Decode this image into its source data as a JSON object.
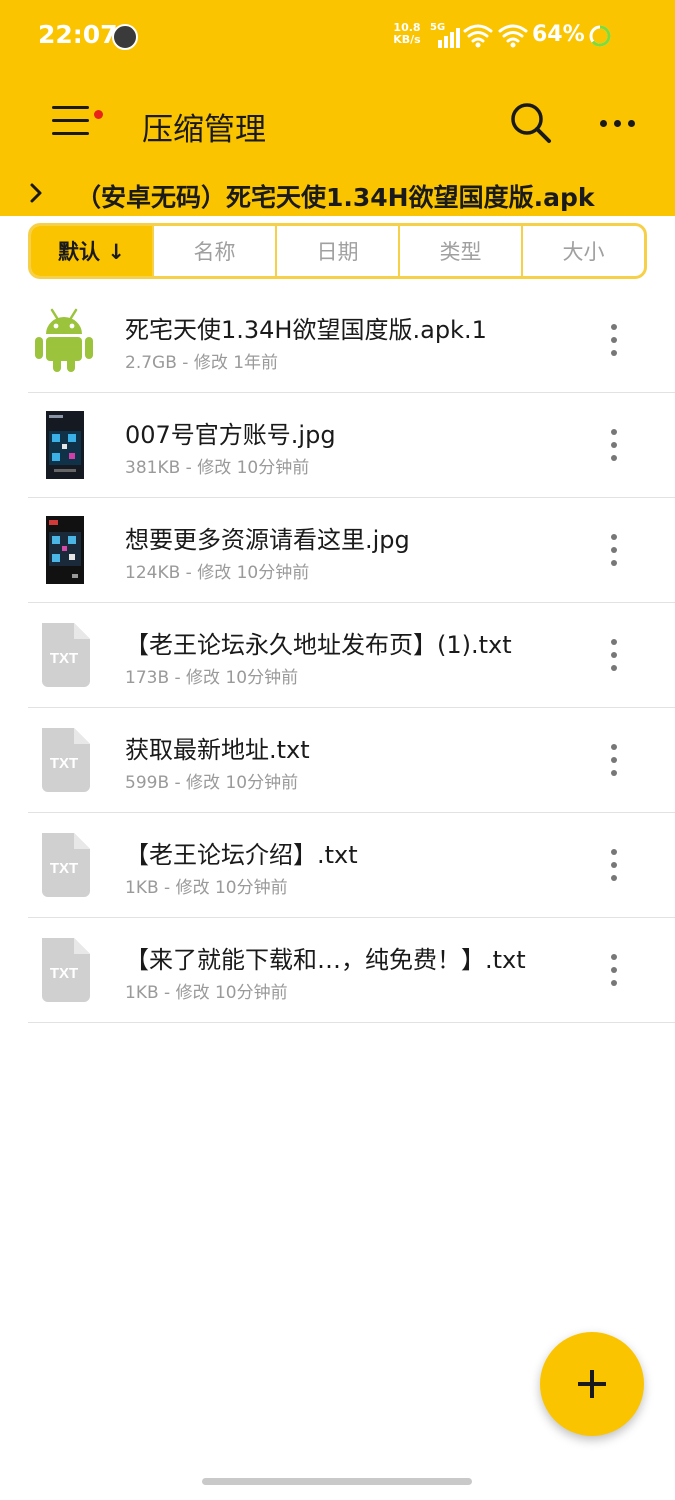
{
  "status_bar": {
    "time": "22:07",
    "net_speed_value": "10.8",
    "net_speed_unit": "KB/s",
    "network_type": "5G",
    "battery_percent": "64%",
    "battery_level": 0.64,
    "icons": [
      "avatar-icon",
      "signal-icon",
      "wifi-icon",
      "wifi-icon",
      "battery-ring-icon"
    ]
  },
  "toolbar": {
    "title": "压缩管理",
    "menu_icon": "hamburger-menu-icon",
    "search_icon": "search-icon",
    "more_icon": "more-dots-icon"
  },
  "breadcrumb": {
    "path": "（安卓无码）死宅天使1.34H欲望国度版.apk"
  },
  "sort_tabs": [
    {
      "label": "默认 ↓",
      "active": true
    },
    {
      "label": "名称",
      "active": false
    },
    {
      "label": "日期",
      "active": false
    },
    {
      "label": "类型",
      "active": false
    },
    {
      "label": "大小",
      "active": false
    }
  ],
  "files": [
    {
      "name": "死宅天使1.34H欲望国度版.apk.1",
      "meta": "2.7GB - 修改 1年前",
      "icon": "android-icon"
    },
    {
      "name": "007号官方账号.jpg",
      "meta": "381KB - 修改 10分钟前",
      "icon": "image-thumbnail"
    },
    {
      "name": "想要更多资源请看这里.jpg",
      "meta": "124KB - 修改 10分钟前",
      "icon": "image-thumbnail"
    },
    {
      "name": "【老王论坛永久地址发布页】(1).txt",
      "meta": "173B - 修改 10分钟前",
      "icon": "txt-file-icon",
      "icon_label": "TXT"
    },
    {
      "name": "获取最新地址.txt",
      "meta": "599B - 修改 10分钟前",
      "icon": "txt-file-icon",
      "icon_label": "TXT"
    },
    {
      "name": "【老王论坛介绍】.txt",
      "meta": "1KB - 修改 10分钟前",
      "icon": "txt-file-icon",
      "icon_label": "TXT"
    },
    {
      "name": "【来了就能下载和…，纯免费！】.txt",
      "meta": "1KB - 修改 10分钟前",
      "icon": "txt-file-icon",
      "icon_label": "TXT"
    }
  ],
  "fab": {
    "icon": "plus-icon"
  },
  "colors": {
    "accent": "#FBC400",
    "notification_dot": "#E8231A",
    "android_green": "#9BC33C",
    "txt_icon_gray": "#D0D0D0",
    "battery_ring": "#7DDC3C"
  }
}
